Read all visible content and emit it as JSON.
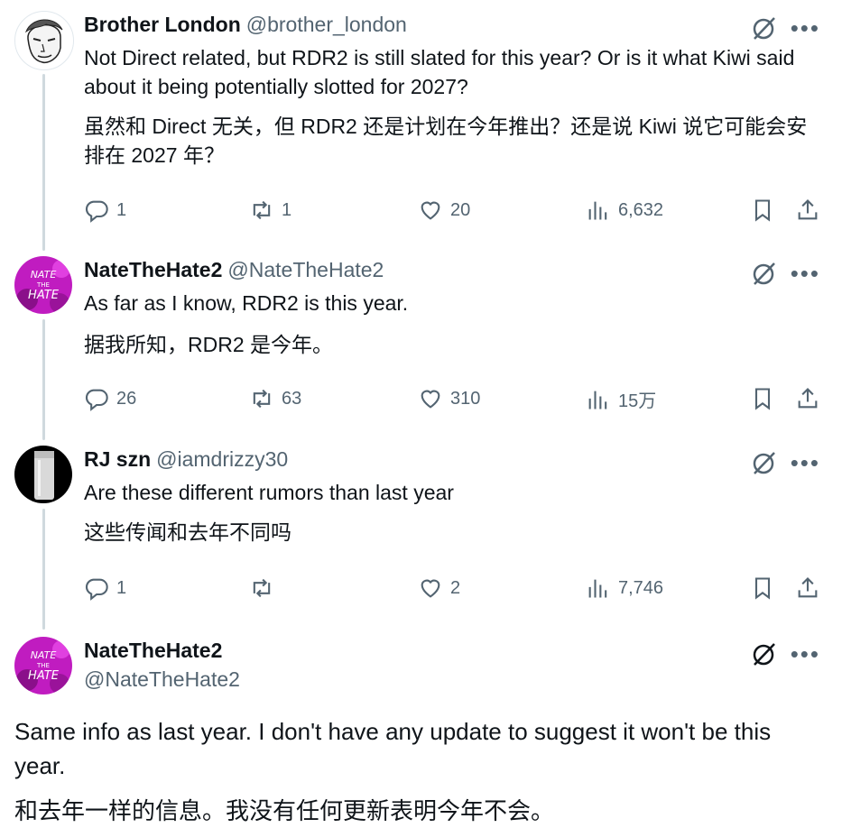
{
  "tweets": [
    {
      "name": "Brother London",
      "handle": "@brother_london",
      "text": "Not Direct related, but RDR2 is still slated for this year? Or is it what Kiwi said about it being potentially slotted for 2027?",
      "translation": "虽然和 Direct 无关，但 RDR2 还是计划在今年推出？还是说 Kiwi 说它可能会安排在 2027 年？",
      "replies": "1",
      "reposts": "1",
      "likes": "20",
      "views": "6,632"
    },
    {
      "name": "NateTheHate2",
      "handle": "@NateTheHate2",
      "text": "As far as I know, RDR2 is this year.",
      "translation": "据我所知，RDR2 是今年。",
      "replies": "26",
      "reposts": "63",
      "likes": "310",
      "views": "15万"
    },
    {
      "name": "RJ szn",
      "handle": "@iamdrizzy30",
      "text": "Are these different rumors than last year",
      "translation": "这些传闻和去年不同吗",
      "replies": "1",
      "reposts": "",
      "likes": "2",
      "views": "7,746"
    }
  ],
  "main": {
    "name": "NateTheHate2",
    "handle": "@NateTheHate2",
    "text": "Same info as last year. I don't have any update to suggest it won't be this year.",
    "translation": "和去年一样的信息。我没有任何更新表明今年不会。"
  },
  "avatar_text": {
    "nate_line1": "NATE",
    "nate_line2": "THE",
    "nate_line3": "HATE"
  },
  "icons": {
    "reply": "reply-icon",
    "repost": "repost-icon",
    "like": "like-icon",
    "views": "views-icon",
    "bookmark": "bookmark-icon",
    "share": "share-icon",
    "grok": "grok-icon",
    "more": "more-icon"
  },
  "colors": {
    "text": "#0f1419",
    "secondary": "#536471",
    "thread_line": "#cfd9de",
    "nate_avatar": "#c01cc0"
  }
}
